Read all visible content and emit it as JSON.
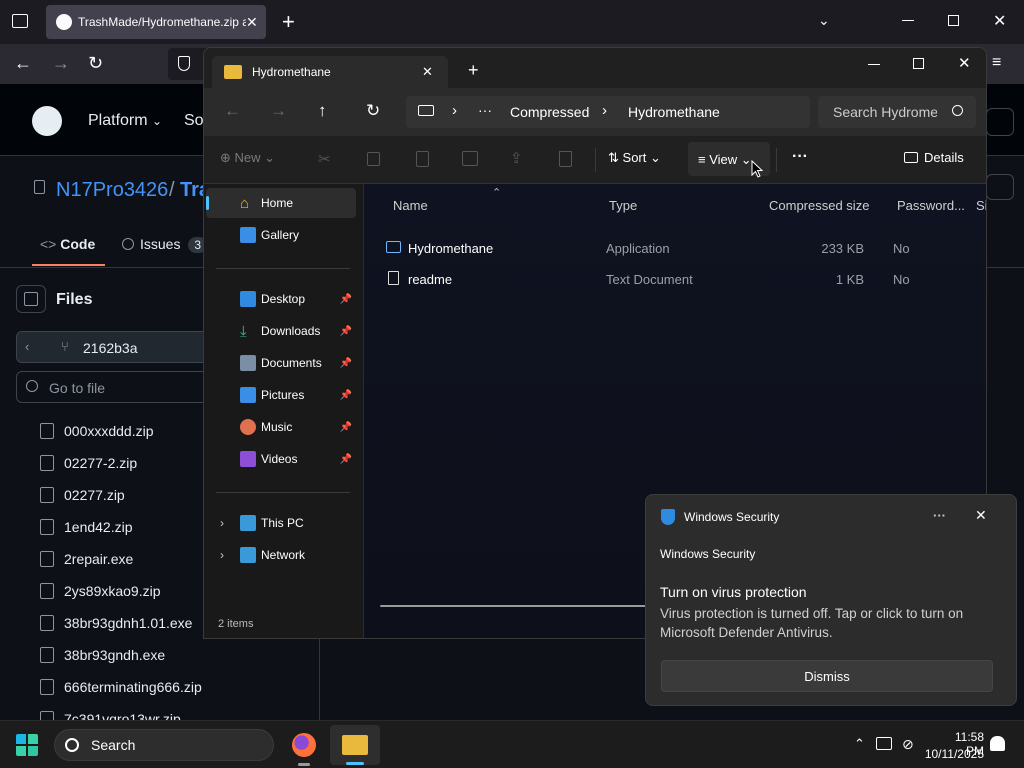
{
  "browser": {
    "tab_title": "TrashMade/Hydromethane.zip a",
    "new_tab": "+"
  },
  "github": {
    "nav_platform": "Platform",
    "nav_so": "So",
    "owner": "N17Pro3426",
    "separator": "/",
    "repo_partial": "Tra",
    "tab_code": "Code",
    "tab_issues": "Issues",
    "issues_count": "3",
    "files_label": "Files",
    "branch": "2162b3a",
    "goto_placeholder": "Go to file",
    "files": [
      "000xxxddd.zip",
      "02277-2.zip",
      "02277.zip",
      "1end42.zip",
      "2repair.exe",
      "2ys89xkao9.zip",
      "38br93gdnh1.01.exe",
      "38br93gndh.exe",
      "666terminating666.zip",
      "7c391vqro13wr.zip"
    ]
  },
  "explorer": {
    "tab_title": "Hydromethane",
    "breadcrumb": [
      "Compressed",
      "Hydromethane"
    ],
    "search_placeholder": "Search Hydrome",
    "cmd": {
      "new": "New",
      "sort": "Sort",
      "view": "View",
      "more": "···",
      "details": "Details"
    },
    "nav": {
      "home": "Home",
      "gallery": "Gallery",
      "desktop": "Desktop",
      "downloads": "Downloads",
      "documents": "Documents",
      "pictures": "Pictures",
      "music": "Music",
      "videos": "Videos",
      "this_pc": "This PC",
      "network": "Network"
    },
    "columns": {
      "name": "Name",
      "type": "Type",
      "compressed_size": "Compressed size",
      "password": "Password...",
      "size_partial": "Si"
    },
    "rows": [
      {
        "name": "Hydromethane",
        "type": "Application",
        "size": "233 KB",
        "password": "No"
      },
      {
        "name": "readme",
        "type": "Text Document",
        "size": "1 KB",
        "password": "No"
      }
    ],
    "status": "2 items"
  },
  "toast": {
    "app": "Windows Security",
    "source": "Windows Security",
    "title": "Turn on virus protection",
    "body": "Virus protection is turned off. Tap or click to turn on Microsoft Defender Antivirus.",
    "more": "···",
    "dismiss": "Dismiss"
  },
  "taskbar": {
    "search": "Search",
    "time": "11:58 PM",
    "date": "10/11/2025"
  },
  "colors": {
    "accent": "#0067c0",
    "github_bg": "#0d1117",
    "toast_bg": "#2c2c2c"
  }
}
